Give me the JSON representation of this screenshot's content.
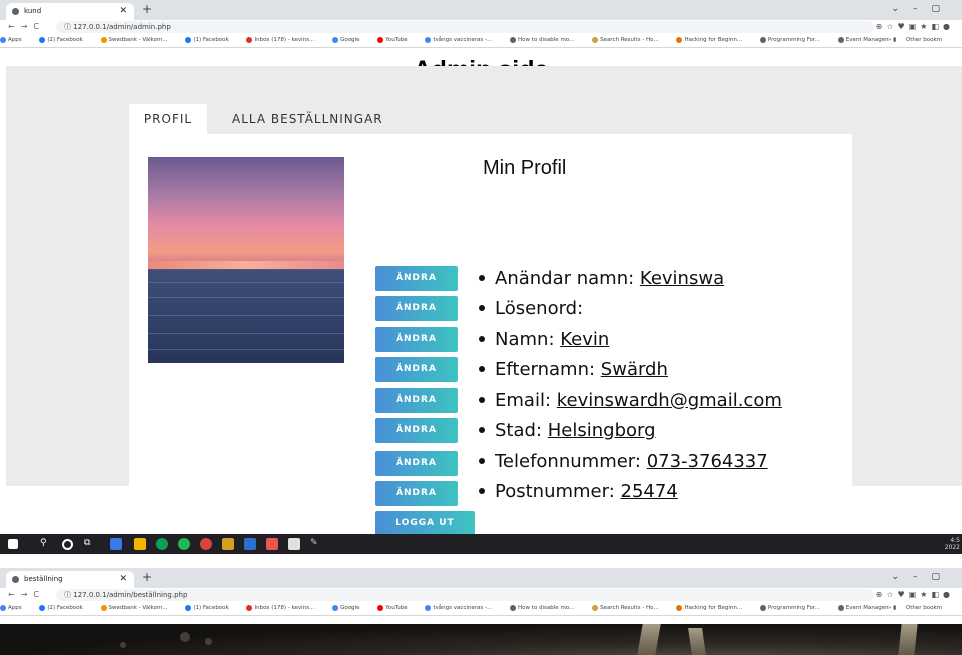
{
  "window1": {
    "tab_title": "kund",
    "url": "127.0.0.1/admin/admin.php"
  },
  "window2": {
    "tab_title": "beställning",
    "url": "127.0.0.1/admin/beställning.php"
  },
  "bookmarks": [
    "Apps",
    "(2) Facebook",
    "Swedbank - Välkom...",
    "(1) Facebook",
    "Inbox (178) - kevins...",
    "Google",
    "YouTube",
    "tvångs vaccineras -...",
    "How to disable mo...",
    "Search Results - Ho...",
    "Hacking for Beginn...",
    "Programming For...",
    "Event Management..."
  ],
  "other_bookmarks": "Other bookm",
  "page": {
    "heading": "Admin sida",
    "tabs": [
      "PROFIL",
      "ALLA BESTÄLLNINGAR"
    ],
    "card_title": "Min Profil",
    "edit_label": "ÄNDRA",
    "logout_label": "LOGGA UT",
    "fields": [
      {
        "label": "Anändar namn:",
        "value": "Kevinswa"
      },
      {
        "label": "Lösenord:",
        "value": ""
      },
      {
        "label": "Namn:",
        "value": "Kevin"
      },
      {
        "label": "Efternamn:",
        "value": "Swärdh "
      },
      {
        "label": "Email:",
        "value": "kevinswardh@gmail.com"
      },
      {
        "label": "Stad:",
        "value": "Helsingborg"
      },
      {
        "label": "Telefonnummer:",
        "value": "073-3764337"
      },
      {
        "label": "Postnummer:",
        "value": "25474"
      }
    ]
  },
  "taskbar": {
    "time": "4:5",
    "date": "2022"
  },
  "colors": {
    "button_start": "#4a8fd6",
    "button_end": "#3ec3c1",
    "panel_bg": "#ebebeb"
  }
}
